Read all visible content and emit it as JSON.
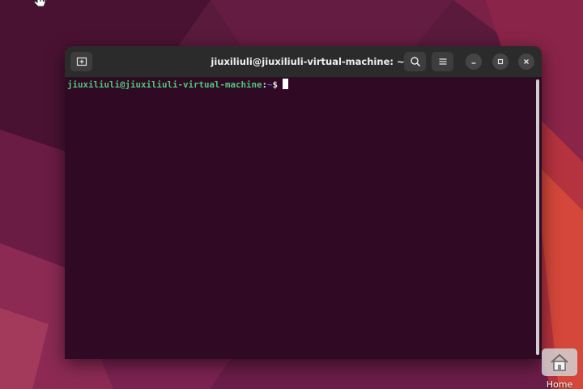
{
  "desktop": {
    "wallpaper_colors": [
      "#5a1a3c",
      "#7a1f4a",
      "#9c2d55",
      "#c0393e",
      "#d9483a"
    ],
    "home_icon": {
      "label": "Home",
      "icon": "home-folder-icon"
    }
  },
  "terminal": {
    "window_title": "jiuxiliuli@jiuxiliuli-virtual-machine: ~",
    "titlebar_buttons": {
      "new_tab": "new-tab-icon",
      "search": "search-icon",
      "menu": "hamburger-menu-icon",
      "minimize": "minimize-icon",
      "maximize": "maximize-icon",
      "close": "close-icon"
    },
    "prompt": {
      "user_host": "jiuxiliuli@jiuxiliuli-virtual-machine",
      "separator": ":",
      "path": "~",
      "symbol": "$"
    },
    "colors": {
      "background": "#300a24",
      "titlebar": "#2b2b2b",
      "user_host": "#4ec97a",
      "path": "#3a74d4"
    }
  }
}
